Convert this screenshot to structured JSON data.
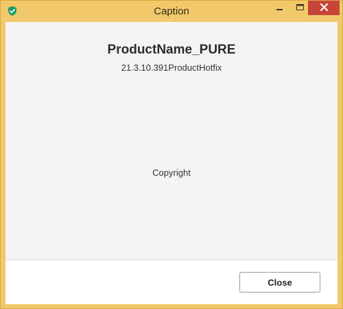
{
  "window": {
    "title": "Caption",
    "icons": {
      "app": "shield-check-icon",
      "minimize": "minimize-icon",
      "maximize": "maximize-icon",
      "close": "close-icon"
    },
    "colors": {
      "frame": "#f2c96a",
      "close_button": "#c7443a",
      "app_icon": "#1e9e6a"
    }
  },
  "about": {
    "product_name": "ProductName_PURE",
    "version": "21.3.10.391ProductHotfix",
    "copyright": "Copyright"
  },
  "footer": {
    "close_label": "Close"
  }
}
